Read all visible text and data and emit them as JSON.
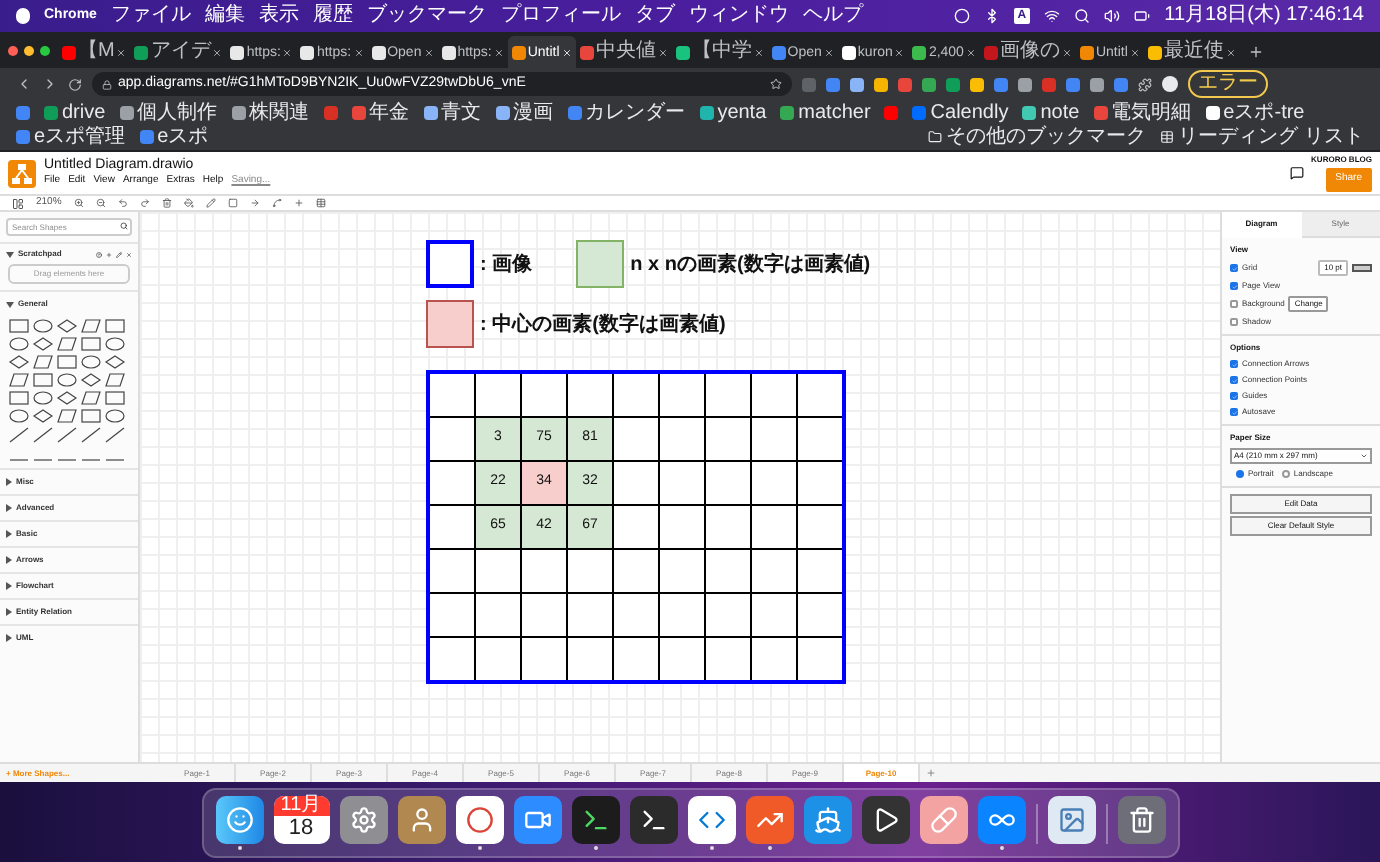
{
  "menubar": {
    "app": "Chrome",
    "menus": [
      "ファイル",
      "編集",
      "表示",
      "履歴",
      "ブックマーク",
      "プロフィール",
      "タブ",
      "ウィンドウ",
      "ヘルプ"
    ],
    "input_source": "A",
    "clock": "11月18日(木) 17:46:14"
  },
  "browser_tabs": [
    {
      "title": "【M",
      "color": "#ff0000",
      "selected": false
    },
    {
      "title": "アイデ",
      "color": "#0f9d58",
      "selected": false
    },
    {
      "title": "https:",
      "color": "#e8e8e8",
      "selected": false
    },
    {
      "title": "https:",
      "color": "#e8e8e8",
      "selected": false
    },
    {
      "title": "Open",
      "color": "#e8e8e8",
      "selected": false
    },
    {
      "title": "https:",
      "color": "#e8e8e8",
      "selected": false
    },
    {
      "title": "Untitl",
      "color": "#f08705",
      "selected": true
    },
    {
      "title": "中央値",
      "color": "#e8453c",
      "selected": false
    },
    {
      "title": "【中学",
      "color": "#19c37d",
      "selected": false
    },
    {
      "title": "Open",
      "color": "#4285f4",
      "selected": false
    },
    {
      "title": "kuron",
      "color": "#ffffff",
      "selected": false
    },
    {
      "title": "2,400",
      "color": "#3dba4e",
      "selected": false
    },
    {
      "title": "画像の",
      "color": "#c4161c",
      "selected": false
    },
    {
      "title": "Untitl",
      "color": "#f08705",
      "selected": false
    },
    {
      "title": "最近使",
      "color": "#fbbc04",
      "selected": false
    }
  ],
  "address_bar": {
    "url": "app.diagrams.net/#G1hMToD9BYN2IK_Uu0wFVZ29twDbU6_vnE",
    "error_button": "エラー"
  },
  "bookmarks": [
    {
      "color": "#4285f4"
    },
    {
      "label": "drive",
      "color": "#0f9d58"
    },
    {
      "label": "個人制作",
      "color": "#9aa0a6"
    },
    {
      "label": "株関連",
      "color": "#9aa0a6"
    },
    {
      "color": "#d93025"
    },
    {
      "label": "年金",
      "color": "#e8453c"
    },
    {
      "label": "青文",
      "color": "#8ab4f8"
    },
    {
      "label": "漫画",
      "color": "#8ab4f8"
    },
    {
      "label": "カレンダー",
      "color": "#4285f4"
    },
    {
      "label": "yenta",
      "color": "#1fb5ad"
    },
    {
      "label": "matcher",
      "color": "#34a853"
    },
    {
      "color": "#ff0000"
    },
    {
      "label": "Calendly",
      "color": "#006bff"
    },
    {
      "label": "note",
      "color": "#41c9b4"
    },
    {
      "label": "電気明細",
      "color": "#e8453c"
    },
    {
      "label": "eスポ-tre",
      "color": "#ffffff"
    },
    {
      "label": "eスポ管理",
      "color": "#4285f4"
    },
    {
      "label": "eスポ",
      "color": "#4285f4"
    }
  ],
  "other_bookmarks": "その他のブックマーク",
  "reading_list": "リーディング リスト",
  "app": {
    "title": "Untitled Diagram.drawio",
    "menus": [
      "File",
      "Edit",
      "View",
      "Arrange",
      "Extras",
      "Help"
    ],
    "status": "Saving...",
    "account": "KURORO BLOG",
    "share": "Share",
    "zoom": "210%"
  },
  "sidebar": {
    "search": {
      "placeholder": "Search Shapes"
    },
    "scratchpad": {
      "title": "Scratchpad",
      "expanded": true,
      "hint": "Drag elements here"
    },
    "sections": [
      {
        "title": "General",
        "expanded": true
      },
      {
        "title": "Misc",
        "expanded": false
      },
      {
        "title": "Advanced",
        "expanded": false
      },
      {
        "title": "Basic",
        "expanded": false
      },
      {
        "title": "Arrows",
        "expanded": false
      },
      {
        "title": "Flowchart",
        "expanded": false
      },
      {
        "title": "Entity Relation",
        "expanded": false
      },
      {
        "title": "UML",
        "expanded": false
      }
    ],
    "more_shapes": "+ More Shapes..."
  },
  "legend": [
    {
      "kind": "image",
      "label": ": 画像"
    },
    {
      "kind": "neighbor",
      "label": "n x nの画素(数字は画素値)"
    },
    {
      "kind": "center",
      "label": ": 中心の画素(数字は画素値)"
    }
  ],
  "grid": [
    [
      {
        "kind": "plain"
      },
      {
        "kind": "plain"
      },
      {
        "kind": "plain"
      },
      {
        "kind": "plain"
      },
      {
        "kind": "plain"
      },
      {
        "kind": "plain"
      },
      {
        "kind": "plain"
      },
      {
        "kind": "plain"
      },
      {
        "kind": "plain"
      }
    ],
    [
      {
        "kind": "plain"
      },
      {
        "kind": "neighbor",
        "value": "3"
      },
      {
        "kind": "neighbor",
        "value": "75"
      },
      {
        "kind": "neighbor",
        "value": "81"
      },
      {
        "kind": "plain"
      },
      {
        "kind": "plain"
      },
      {
        "kind": "plain"
      },
      {
        "kind": "plain"
      },
      {
        "kind": "plain"
      }
    ],
    [
      {
        "kind": "plain"
      },
      {
        "kind": "neighbor",
        "value": "22"
      },
      {
        "kind": "center",
        "value": "34"
      },
      {
        "kind": "neighbor",
        "value": "32"
      },
      {
        "kind": "plain"
      },
      {
        "kind": "plain"
      },
      {
        "kind": "plain"
      },
      {
        "kind": "plain"
      },
      {
        "kind": "plain"
      }
    ],
    [
      {
        "kind": "plain"
      },
      {
        "kind": "neighbor",
        "value": "65"
      },
      {
        "kind": "neighbor",
        "value": "42"
      },
      {
        "kind": "neighbor",
        "value": "67"
      },
      {
        "kind": "plain"
      },
      {
        "kind": "plain"
      },
      {
        "kind": "plain"
      },
      {
        "kind": "plain"
      },
      {
        "kind": "plain"
      }
    ],
    [
      {
        "kind": "plain"
      },
      {
        "kind": "plain"
      },
      {
        "kind": "plain"
      },
      {
        "kind": "plain"
      },
      {
        "kind": "plain"
      },
      {
        "kind": "plain"
      },
      {
        "kind": "plain"
      },
      {
        "kind": "plain"
      },
      {
        "kind": "plain"
      }
    ],
    [
      {
        "kind": "plain"
      },
      {
        "kind": "plain"
      },
      {
        "kind": "plain"
      },
      {
        "kind": "plain"
      },
      {
        "kind": "plain"
      },
      {
        "kind": "plain"
      },
      {
        "kind": "plain"
      },
      {
        "kind": "plain"
      },
      {
        "kind": "plain"
      }
    ],
    [
      {
        "kind": "plain"
      },
      {
        "kind": "plain"
      },
      {
        "kind": "plain"
      },
      {
        "kind": "plain"
      },
      {
        "kind": "plain"
      },
      {
        "kind": "plain"
      },
      {
        "kind": "plain"
      },
      {
        "kind": "plain"
      },
      {
        "kind": "plain"
      }
    ]
  ],
  "format_panel": {
    "tabs": [
      {
        "label": "Diagram",
        "selected": true
      },
      {
        "label": "Style",
        "selected": false
      }
    ],
    "view_title": "View",
    "view": [
      {
        "label": "Grid",
        "checked": true
      },
      {
        "label": "Page View",
        "checked": true
      },
      {
        "label": "Background",
        "checked": false
      },
      {
        "label": "Shadow",
        "checked": false
      }
    ],
    "grid_size": "10 pt",
    "change_button": "Change",
    "options_title": "Options",
    "options": [
      {
        "label": "Connection Arrows",
        "checked": true
      },
      {
        "label": "Connection Points",
        "checked": true
      },
      {
        "label": "Guides",
        "checked": true
      },
      {
        "label": "Autosave",
        "checked": true
      }
    ],
    "paper_title": "Paper Size",
    "paper": "A4 (210 mm x 297 mm)",
    "orientation": [
      {
        "label": "Portrait",
        "selected": true
      },
      {
        "label": "Landscape",
        "selected": false
      }
    ],
    "buttons": [
      "Edit Data",
      "Clear Default Style"
    ]
  },
  "pages": [
    {
      "label": "Page-1",
      "selected": false
    },
    {
      "label": "Page-2",
      "selected": false
    },
    {
      "label": "Page-3",
      "selected": false
    },
    {
      "label": "Page-4",
      "selected": false
    },
    {
      "label": "Page-5",
      "selected": false
    },
    {
      "label": "Page-6",
      "selected": false
    },
    {
      "label": "Page-7",
      "selected": false
    },
    {
      "label": "Page-8",
      "selected": false
    },
    {
      "label": "Page-9",
      "selected": false
    },
    {
      "label": "Page-10",
      "selected": true
    }
  ],
  "dock": [
    {
      "kind": "finder",
      "running": true
    },
    {
      "kind": "calendar",
      "month": "11月",
      "day": "18",
      "running": false
    },
    {
      "kind": "settings",
      "running": false
    },
    {
      "kind": "contacts",
      "running": false
    },
    {
      "kind": "chrome",
      "running": true
    },
    {
      "kind": "zoom",
      "running": false
    },
    {
      "kind": "iterm",
      "running": true
    },
    {
      "kind": "terminal",
      "running": false
    },
    {
      "kind": "vscode",
      "running": true
    },
    {
      "kind": "trend",
      "running": true
    },
    {
      "kind": "docker",
      "running": false
    },
    {
      "kind": "quicktime",
      "running": false
    },
    {
      "kind": "pill",
      "running": false
    },
    {
      "kind": "infinity",
      "running": true
    },
    {
      "kind": "divider"
    },
    {
      "kind": "preview",
      "running": false
    },
    {
      "kind": "divider"
    },
    {
      "kind": "trash",
      "running": false
    }
  ]
}
